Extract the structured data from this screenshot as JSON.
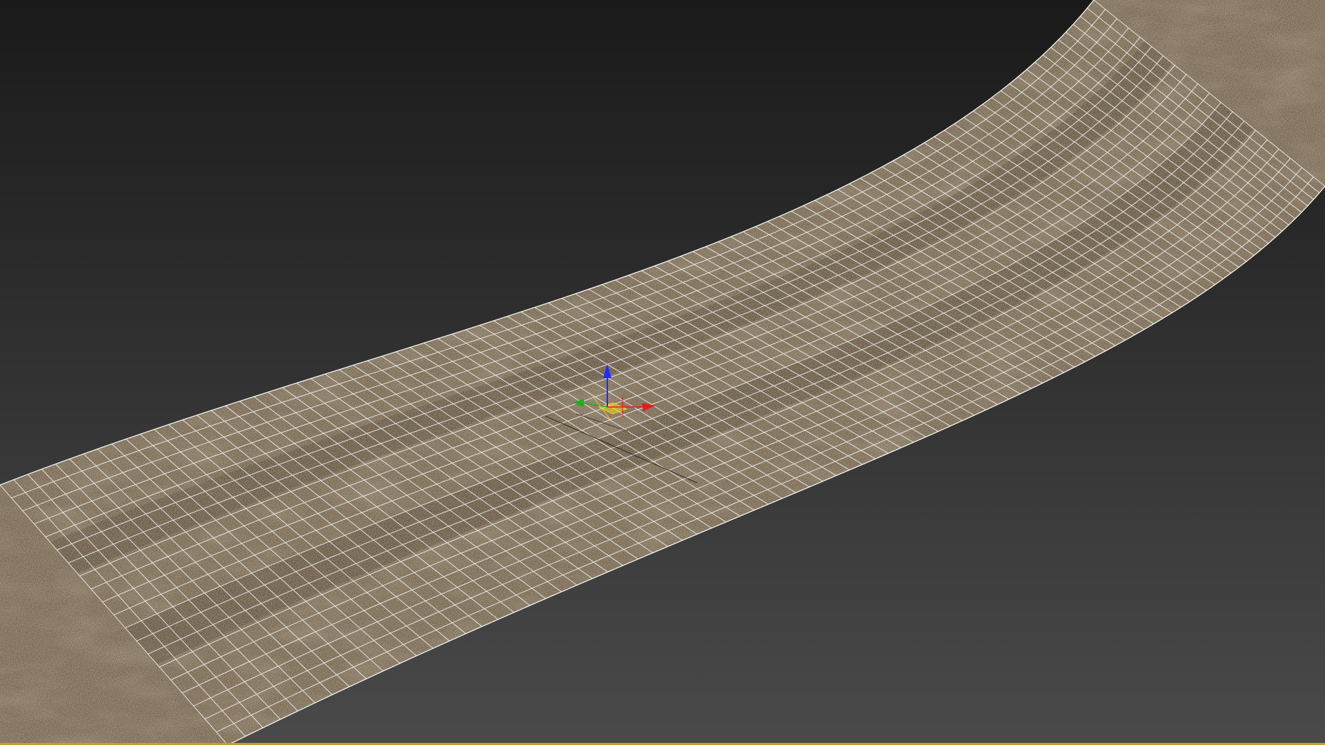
{
  "viewport": {
    "background_top": "#1a1a1a",
    "background_bottom": "#4a4a4a",
    "wireframe_color": "#ffffff",
    "selection_border_color": "#c2a12b",
    "road_texture": {
      "base": "#6e5f48",
      "light": "#8e7d62",
      "dark": "#3f3425",
      "rut": "#4a3c2c"
    }
  },
  "gizmo": {
    "z_axis_color": "#1f2bff",
    "x_axis_color": "#e51a1a",
    "y_axis_color": "#1fae1f",
    "plane_color": "#f2d21e",
    "icons": [
      "move-gizmo-icon"
    ]
  }
}
